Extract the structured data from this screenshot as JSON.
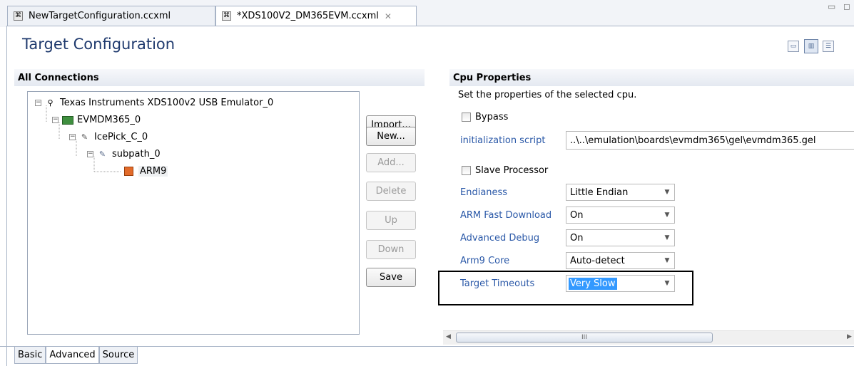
{
  "tabs": [
    {
      "label": "NewTargetConfiguration.ccxml",
      "active": false
    },
    {
      "label": "*XDS100V2_DM365EVM.ccxml",
      "active": true
    }
  ],
  "page_title": "Target Configuration",
  "connections": {
    "header": "All Connections",
    "tree": [
      {
        "label": "Texas Instruments XDS100v2 USB Emulator_0",
        "icon": "emulator-icon"
      },
      {
        "label": "EVMDM365_0",
        "icon": "board-icon"
      },
      {
        "label": "IcePick_C_0",
        "icon": "router-icon"
      },
      {
        "label": "subpath_0",
        "icon": "subpath-icon"
      },
      {
        "label": "ARM9",
        "icon": "cpu-icon",
        "selected": true
      }
    ],
    "buttons": {
      "import": "Import...",
      "new": "New...",
      "add": "Add...",
      "delete": "Delete",
      "up": "Up",
      "down": "Down",
      "save": "Save"
    }
  },
  "cpu_properties": {
    "header": "Cpu Properties",
    "description": "Set the properties of the selected cpu.",
    "bypass_label": "Bypass",
    "init_script_label": "initialization script",
    "init_script_value": "..\\..\\emulation\\boards\\evmdm365\\gel\\evmdm365.gel",
    "slave_label": "Slave Processor",
    "endianess_label": "Endianess",
    "endianess_value": "Little Endian",
    "arm_fast_download_label": "ARM Fast Download",
    "arm_fast_download_value": "On",
    "advanced_debug_label": "Advanced Debug",
    "advanced_debug_value": "On",
    "arm9_core_label": "Arm9 Core",
    "arm9_core_value": "Auto-detect",
    "target_timeouts_label": "Target Timeouts",
    "target_timeouts_value": "Very Slow"
  },
  "scrollbar": {
    "thumb_glyph": "III"
  },
  "bottom_tabs": [
    "Basic",
    "Advanced",
    "Source"
  ],
  "colors": {
    "accent_label": "#2b59a8",
    "title": "#1f3a6e",
    "selection": "#3399ff",
    "highlight_box": "#000000"
  }
}
